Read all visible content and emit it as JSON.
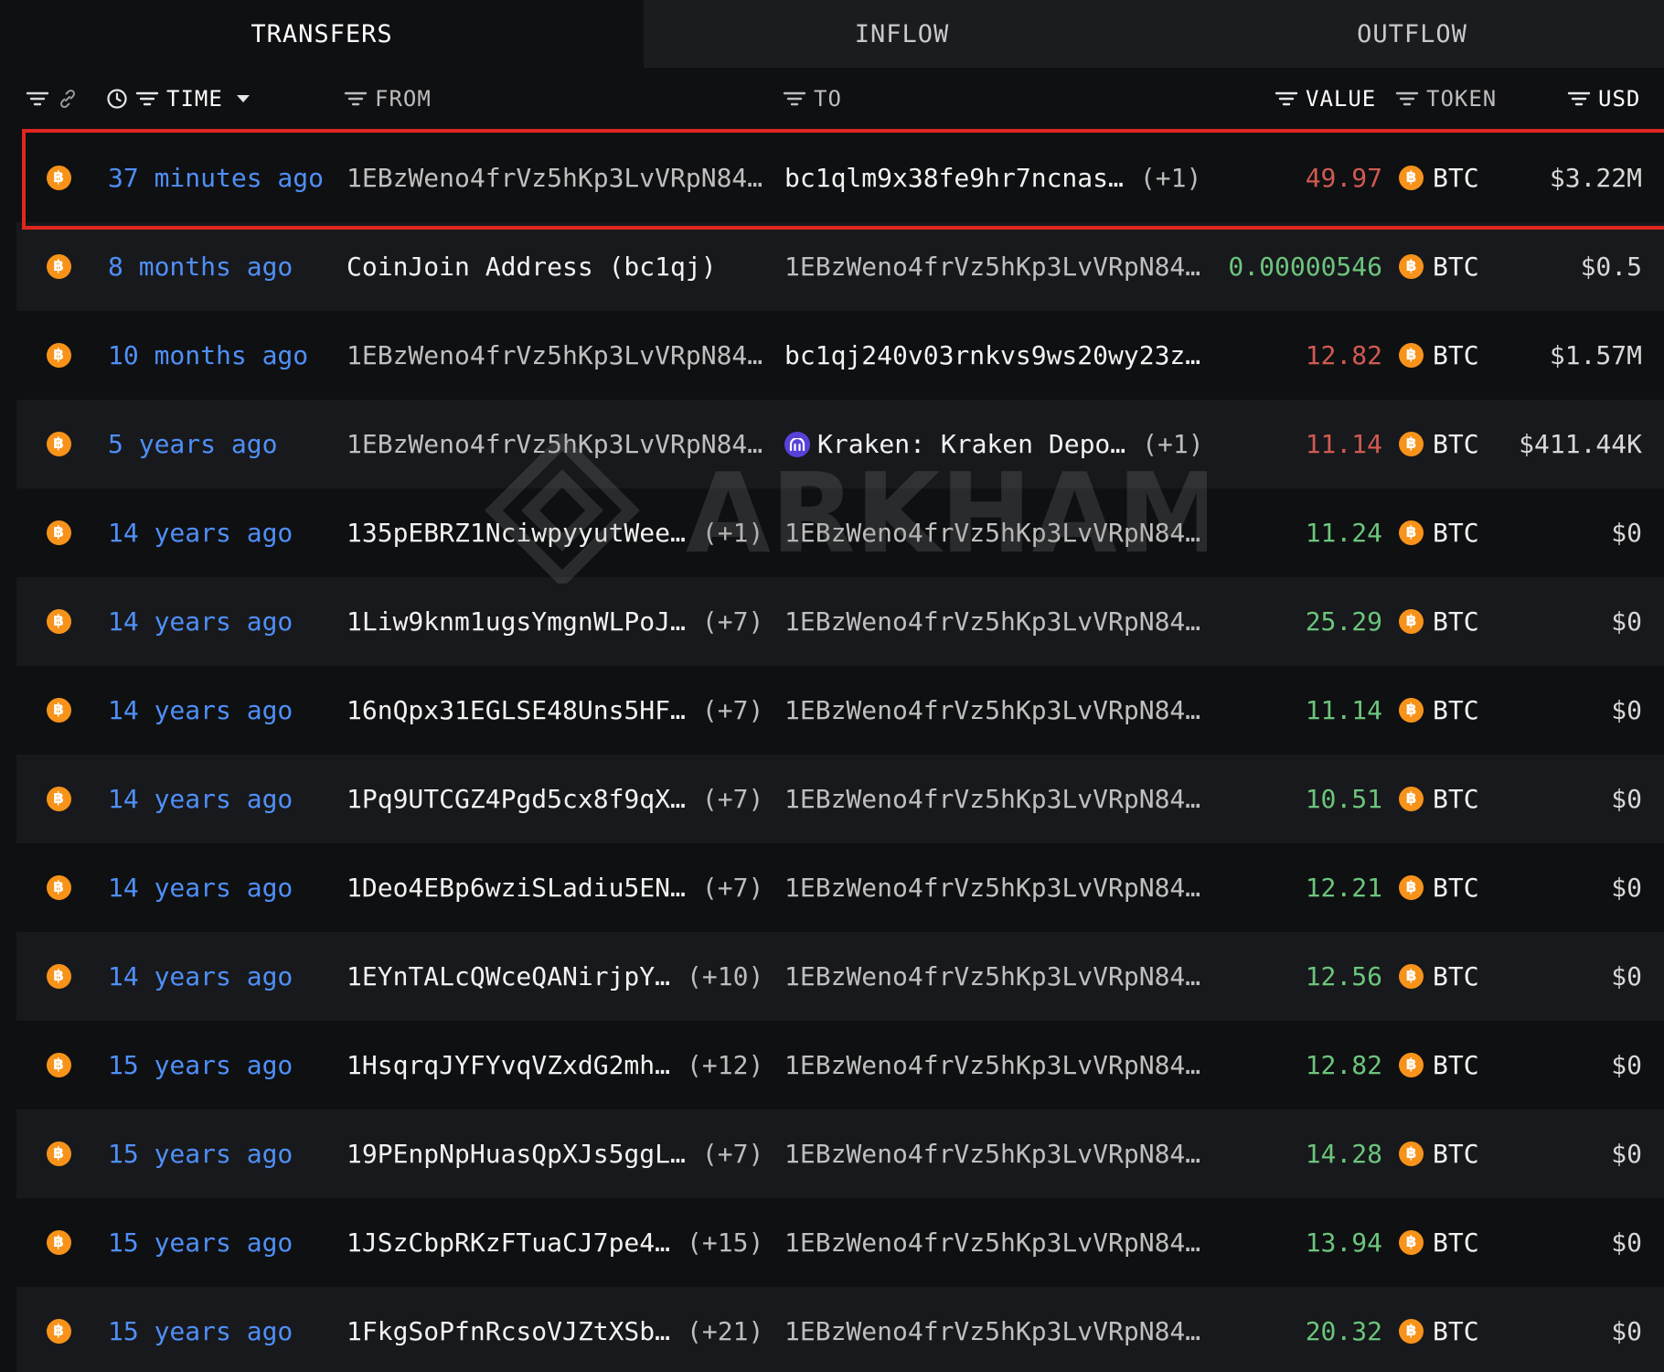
{
  "tabs": [
    {
      "label": "TRANSFERS",
      "active": true
    },
    {
      "label": "INFLOW",
      "active": false
    },
    {
      "label": "OUTFLOW",
      "active": false
    }
  ],
  "header": {
    "time": "TIME",
    "from": "FROM",
    "to": "TO",
    "value": "VALUE",
    "token": "TOKEN",
    "usd": "USD"
  },
  "watermark": "ARKHAM",
  "colors": {
    "accent_blue": "#4f8ff7",
    "value_out": "#d05a52",
    "value_in": "#6cc57c",
    "btc": "#f7931a",
    "highlight": "#e0261f"
  },
  "rows": [
    {
      "time": "37 minutes ago",
      "from": "1EBzWeno4frVz5hKp3LvVRpN84…",
      "from_extra": "",
      "to": "bc1qlm9x38fe9hr7ncnas…",
      "to_extra": "(+1)",
      "to_entity": "",
      "value": "49.97",
      "direction": "out",
      "token": "BTC",
      "usd": "$3.22M"
    },
    {
      "time": "8 months ago",
      "from": "CoinJoin Address (bc1qj)",
      "from_extra": "",
      "to": "1EBzWeno4frVz5hKp3LvVRpN84…",
      "to_extra": "",
      "to_entity": "",
      "value": "0.00000546",
      "direction": "in",
      "token": "BTC",
      "usd": "$0.5"
    },
    {
      "time": "10 months ago",
      "from": "1EBzWeno4frVz5hKp3LvVRpN84…",
      "from_extra": "",
      "to": "bc1qj240v03rnkvs9ws20wy23z…",
      "to_extra": "",
      "to_entity": "",
      "value": "12.82",
      "direction": "out",
      "token": "BTC",
      "usd": "$1.57M"
    },
    {
      "time": "5 years ago",
      "from": "1EBzWeno4frVz5hKp3LvVRpN84…",
      "from_extra": "",
      "to": "Kraken: Kraken Depo…",
      "to_extra": "(+1)",
      "to_entity": "kraken",
      "value": "11.14",
      "direction": "out",
      "token": "BTC",
      "usd": "$411.44K"
    },
    {
      "time": "14 years ago",
      "from": "135pEBRZ1NciwpyyutWee…",
      "from_extra": "(+1)",
      "to": "1EBzWeno4frVz5hKp3LvVRpN84…",
      "to_extra": "",
      "to_entity": "",
      "value": "11.24",
      "direction": "in",
      "token": "BTC",
      "usd": "$0"
    },
    {
      "time": "14 years ago",
      "from": "1Liw9knm1ugsYmgnWLPoJ…",
      "from_extra": "(+7)",
      "to": "1EBzWeno4frVz5hKp3LvVRpN84…",
      "to_extra": "",
      "to_entity": "",
      "value": "25.29",
      "direction": "in",
      "token": "BTC",
      "usd": "$0"
    },
    {
      "time": "14 years ago",
      "from": "16nQpx31EGLSE48Uns5HF…",
      "from_extra": "(+7)",
      "to": "1EBzWeno4frVz5hKp3LvVRpN84…",
      "to_extra": "",
      "to_entity": "",
      "value": "11.14",
      "direction": "in",
      "token": "BTC",
      "usd": "$0"
    },
    {
      "time": "14 years ago",
      "from": "1Pq9UTCGZ4Pgd5cx8f9qX…",
      "from_extra": "(+7)",
      "to": "1EBzWeno4frVz5hKp3LvVRpN84…",
      "to_extra": "",
      "to_entity": "",
      "value": "10.51",
      "direction": "in",
      "token": "BTC",
      "usd": "$0"
    },
    {
      "time": "14 years ago",
      "from": "1Deo4EBp6wziSLadiu5EN…",
      "from_extra": "(+7)",
      "to": "1EBzWeno4frVz5hKp3LvVRpN84…",
      "to_extra": "",
      "to_entity": "",
      "value": "12.21",
      "direction": "in",
      "token": "BTC",
      "usd": "$0"
    },
    {
      "time": "14 years ago",
      "from": "1EYnTALcQWceQANirjpY…",
      "from_extra": "(+10)",
      "to": "1EBzWeno4frVz5hKp3LvVRpN84…",
      "to_extra": "",
      "to_entity": "",
      "value": "12.56",
      "direction": "in",
      "token": "BTC",
      "usd": "$0"
    },
    {
      "time": "15 years ago",
      "from": "1HsqrqJYFYvqVZxdG2mh…",
      "from_extra": "(+12)",
      "to": "1EBzWeno4frVz5hKp3LvVRpN84…",
      "to_extra": "",
      "to_entity": "",
      "value": "12.82",
      "direction": "in",
      "token": "BTC",
      "usd": "$0"
    },
    {
      "time": "15 years ago",
      "from": "19PEnpNpHuasQpXJs5ggL…",
      "from_extra": "(+7)",
      "to": "1EBzWeno4frVz5hKp3LvVRpN84…",
      "to_extra": "",
      "to_entity": "",
      "value": "14.28",
      "direction": "in",
      "token": "BTC",
      "usd": "$0"
    },
    {
      "time": "15 years ago",
      "from": "1JSzCbpRKzFTuaCJ7pe4…",
      "from_extra": "(+15)",
      "to": "1EBzWeno4frVz5hKp3LvVRpN84…",
      "to_extra": "",
      "to_entity": "",
      "value": "13.94",
      "direction": "in",
      "token": "BTC",
      "usd": "$0"
    },
    {
      "time": "15 years ago",
      "from": "1FkgSoPfnRcsoVJZtXSb…",
      "from_extra": "(+21)",
      "to": "1EBzWeno4frVz5hKp3LvVRpN84…",
      "to_extra": "",
      "to_entity": "",
      "value": "20.32",
      "direction": "in",
      "token": "BTC",
      "usd": "$0"
    }
  ]
}
